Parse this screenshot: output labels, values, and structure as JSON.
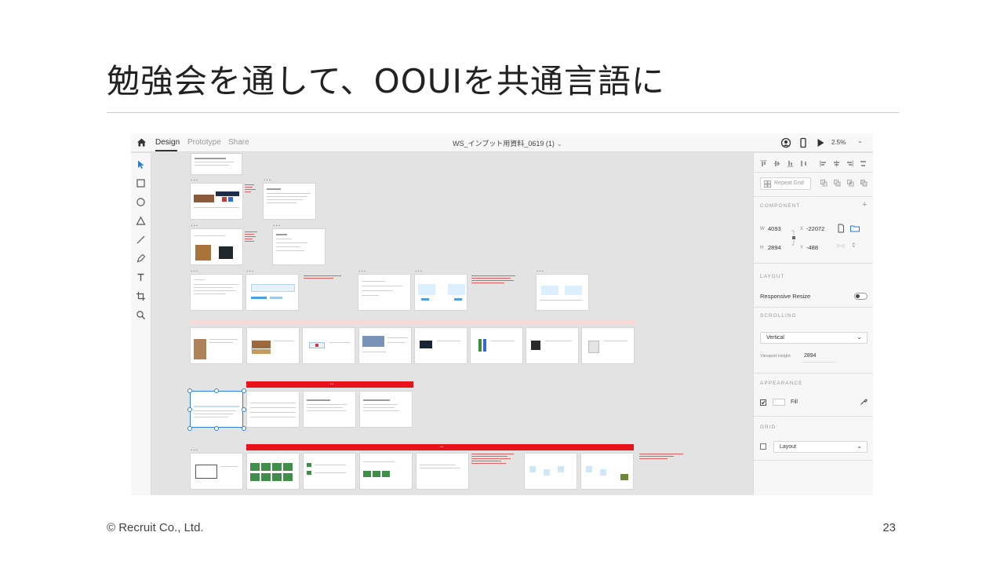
{
  "slide": {
    "title": "勉強会を通して、OOUIを共通言語に",
    "footer": "© Recruit Co., Ltd.",
    "page_number": "23"
  },
  "xd": {
    "tabs": [
      "Design",
      "Prototype",
      "Share"
    ],
    "document_title": "WS_インプット用資料_0619 (1)",
    "zoom": "2.5%",
    "tools": [
      "select-tool",
      "rectangle-tool",
      "ellipse-tool",
      "polygon-tool",
      "line-tool",
      "pen-tool",
      "text-tool",
      "artboard-tool",
      "zoom-tool"
    ],
    "panel": {
      "repeat_grid": "Repeat Grid",
      "component_header": "COMPONENT",
      "w_label": "W",
      "w_value": "4093",
      "h_label": "H",
      "h_value": "2894",
      "x_label": "X",
      "x_value": "-22072",
      "y_label": "Y",
      "y_value": "-488",
      "layout_header": "LAYOUT",
      "responsive_resize": "Responsive Resize",
      "scrolling_header": "SCROLLING",
      "scrolling_value": "Vertical",
      "viewport_height_label": "Viewport Height",
      "viewport_height_value": "2894",
      "appearance_header": "APPEARANCE",
      "fill_label": "Fill",
      "grid_header": "GRID",
      "grid_value": "Layout"
    },
    "colors": {
      "banner": "#e8131a",
      "selection": "#2f7fe6",
      "accent_blue": "#4aa3df"
    }
  }
}
